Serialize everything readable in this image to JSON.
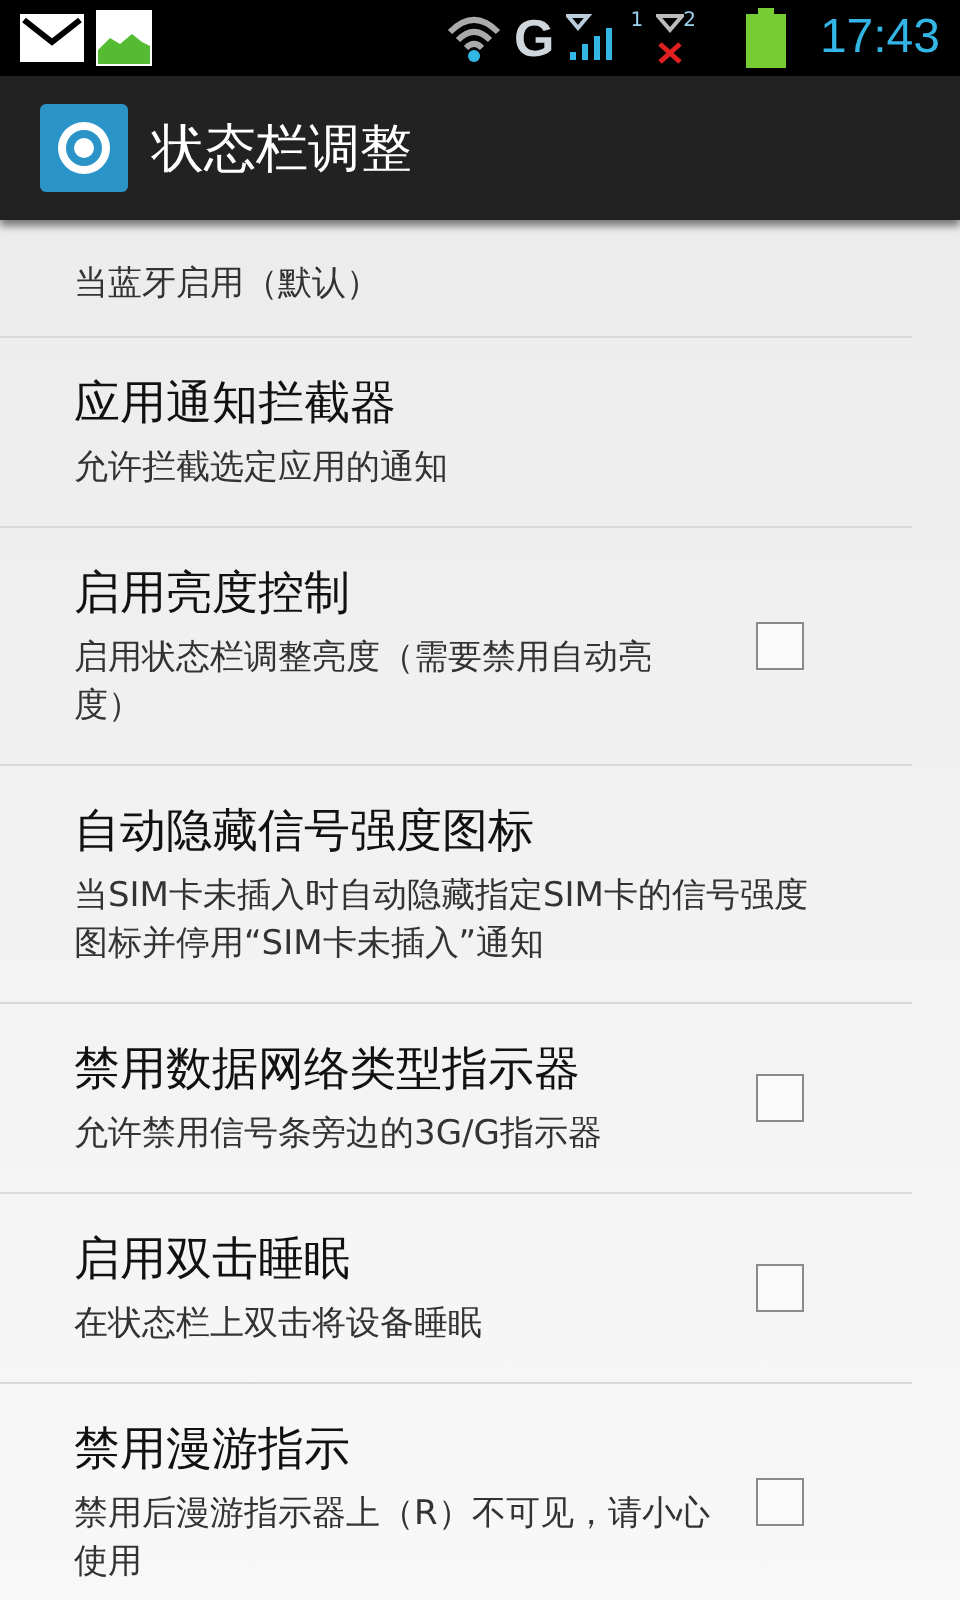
{
  "status_bar": {
    "network_type": "G",
    "sim_1": "1",
    "sim_2": "2",
    "time": "17:43"
  },
  "action_bar": {
    "title": "状态栏调整"
  },
  "items": [
    {
      "kind": "plain",
      "summary": "当蓝牙启用（默认）"
    },
    {
      "kind": "plain",
      "title": "应用通知拦截器",
      "summary": "允许拦截选定应用的通知"
    },
    {
      "kind": "checkbox",
      "title": "启用亮度控制",
      "summary": "启用状态栏调整亮度（需要禁用自动亮度）",
      "checked": false
    },
    {
      "kind": "plain",
      "title": "自动隐藏信号强度图标",
      "summary": "当SIM卡未插入时自动隐藏指定SIM卡的信号强度图标并停用“SIM卡未插入”通知"
    },
    {
      "kind": "checkbox",
      "title": "禁用数据网络类型指示器",
      "summary": "允许禁用信号条旁边的3G/G指示器",
      "checked": false
    },
    {
      "kind": "checkbox",
      "title": "启用双击睡眠",
      "summary": "在状态栏上双击将设备睡眠",
      "checked": false
    },
    {
      "kind": "checkbox",
      "title": "禁用漫游指示",
      "summary": "禁用后漫游指示器上（R）不可见，请小心使用",
      "checked": false
    }
  ]
}
